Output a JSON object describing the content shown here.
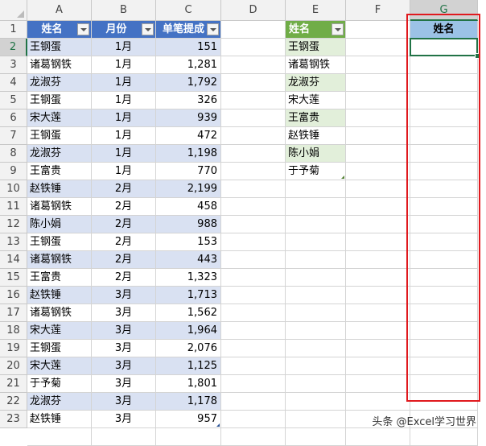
{
  "columns": [
    "A",
    "B",
    "C",
    "D",
    "E",
    "F",
    "G"
  ],
  "rows": [
    "1",
    "2",
    "3",
    "4",
    "5",
    "6",
    "7",
    "8",
    "9",
    "10",
    "11",
    "12",
    "13",
    "14",
    "15",
    "16",
    "17",
    "18",
    "19",
    "20",
    "21",
    "22",
    "23"
  ],
  "table1": {
    "headers": [
      "姓名",
      "月份",
      "单笔提成"
    ],
    "rows": [
      [
        "王钢蛋",
        "1月",
        "151"
      ],
      [
        "诸葛钢铁",
        "1月",
        "1,281"
      ],
      [
        "龙淑芬",
        "1月",
        "1,792"
      ],
      [
        "王钢蛋",
        "1月",
        "326"
      ],
      [
        "宋大莲",
        "1月",
        "939"
      ],
      [
        "王钢蛋",
        "1月",
        "472"
      ],
      [
        "龙淑芬",
        "1月",
        "1,198"
      ],
      [
        "王富贵",
        "1月",
        "770"
      ],
      [
        "赵铁锤",
        "2月",
        "2,199"
      ],
      [
        "诸葛钢铁",
        "2月",
        "458"
      ],
      [
        "陈小娟",
        "2月",
        "988"
      ],
      [
        "王钢蛋",
        "2月",
        "153"
      ],
      [
        "诸葛钢铁",
        "2月",
        "443"
      ],
      [
        "王富贵",
        "2月",
        "1,323"
      ],
      [
        "赵铁锤",
        "3月",
        "1,713"
      ],
      [
        "诸葛钢铁",
        "3月",
        "1,562"
      ],
      [
        "宋大莲",
        "3月",
        "1,964"
      ],
      [
        "王钢蛋",
        "3月",
        "2,076"
      ],
      [
        "宋大莲",
        "3月",
        "1,125"
      ],
      [
        "于予菊",
        "3月",
        "1,801"
      ],
      [
        "龙淑芬",
        "3月",
        "1,178"
      ],
      [
        "赵铁锤",
        "3月",
        "957"
      ]
    ]
  },
  "table2": {
    "header": "姓名",
    "items": [
      "王钢蛋",
      "诸葛钢铁",
      "龙淑芬",
      "宋大莲",
      "王富贵",
      "赵铁锤",
      "陈小娟",
      "于予菊"
    ]
  },
  "table3": {
    "header": "姓名",
    "active_cell_value": ""
  },
  "selection": {
    "active_cell": "G2"
  },
  "watermark": "头条 @Excel学习世界",
  "colors": {
    "table1_header": "#4472c4",
    "table1_band": "#d9e1f2",
    "table2_header": "#70ad47",
    "table2_band": "#e2efda",
    "table3_header": "#9bc2e6",
    "highlight_frame": "#e0191e",
    "selection": "#217346"
  }
}
